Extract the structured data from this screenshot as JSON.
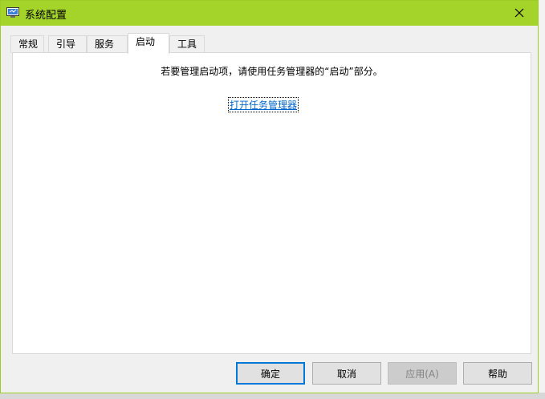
{
  "window": {
    "title": "系统配置"
  },
  "tabs": [
    {
      "label": "常规"
    },
    {
      "label": "引导"
    },
    {
      "label": "服务"
    },
    {
      "label": "启动",
      "active": true
    },
    {
      "label": "工具"
    }
  ],
  "startup": {
    "message": "若要管理启动项，请使用任务管理器的“启动”部分。",
    "link_label": "打开任务管理器"
  },
  "buttons": {
    "ok": "确定",
    "cancel": "取消",
    "apply": "应用(A)",
    "help": "帮助"
  },
  "colors": {
    "titlebar": "#a4d32a",
    "link": "#0066cc",
    "default_button_border": "#0078d7"
  }
}
